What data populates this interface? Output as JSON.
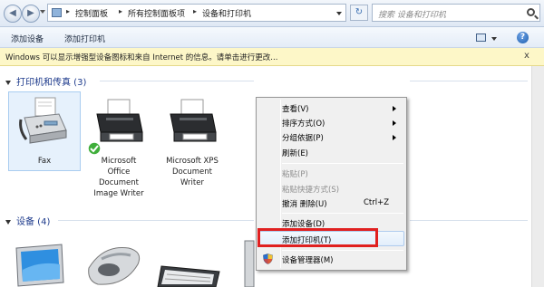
{
  "address_bar": {
    "crumbs": [
      "控制面板",
      "所有控制面板项",
      "设备和打印机"
    ],
    "search_placeholder": "搜索 设备和打印机",
    "refresh_glyph": "↻"
  },
  "command_bar": {
    "add_device": "添加设备",
    "add_printer": "添加打印机",
    "help_glyph": "?"
  },
  "info_bar": {
    "message": "Windows 可以显示增强型设备图标和来自 Internet 的信息。请单击进行更改...",
    "close": "x"
  },
  "printers_group": {
    "label": "打印机和传真 (3)"
  },
  "printers": [
    {
      "name_lines": [
        "Fax"
      ]
    },
    {
      "name_lines": [
        "Microsoft",
        "Office",
        "Document",
        "Image Writer"
      ],
      "default": true
    },
    {
      "name_lines": [
        "Microsoft XPS",
        "Document",
        "Writer"
      ]
    }
  ],
  "devices_group": {
    "label": "设备 (4)"
  },
  "context_menu": {
    "items": [
      {
        "label": "查看(V)",
        "submenu": true
      },
      {
        "label": "排序方式(O)",
        "submenu": true
      },
      {
        "label": "分组依据(P)",
        "submenu": true
      },
      {
        "label": "刷新(E)"
      },
      {
        "label": "粘贴(P)",
        "disabled": true
      },
      {
        "label": "粘贴快捷方式(S)",
        "disabled": true
      },
      {
        "label": "撤消 删除(U)",
        "shortcut": "Ctrl+Z"
      },
      {
        "label": "添加设备(D)"
      },
      {
        "label": "添加打印机(T)",
        "highlighted": true
      },
      {
        "label": "设备管理器(M)",
        "icon": "uac-shield-icon"
      }
    ]
  },
  "colors": {
    "highlight_box": "#e02020",
    "info_bar": "#fdf7c8",
    "group_text": "#1e3b8c"
  }
}
